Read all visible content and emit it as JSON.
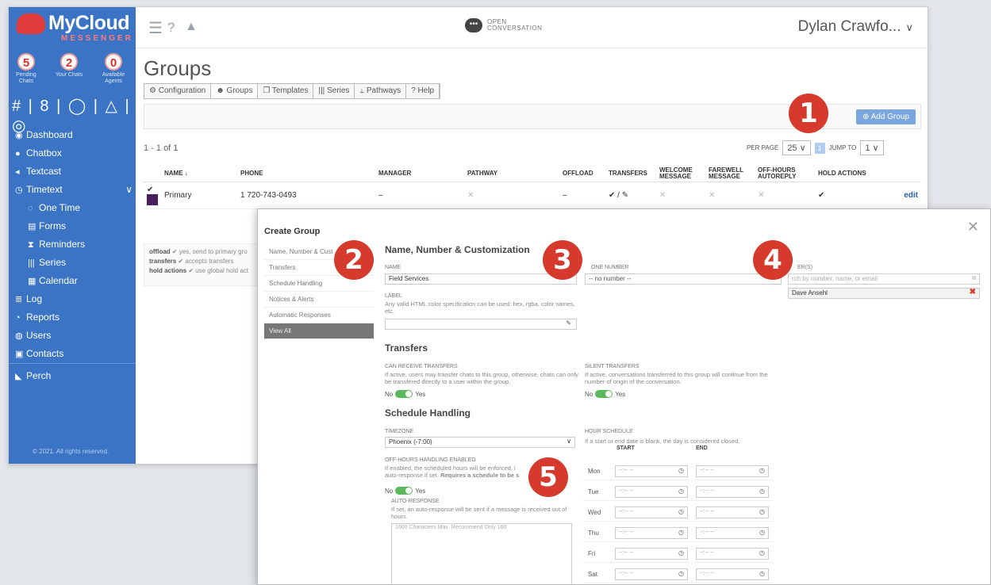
{
  "logo": {
    "title": "MyCloud",
    "subtitle": "MESSENGER"
  },
  "center_brand": {
    "line1": "OPEN",
    "line2": "CONVERSATION"
  },
  "user": {
    "name": "Dylan Crawfo..."
  },
  "stats": [
    {
      "num": "5",
      "label": "Pending Chats"
    },
    {
      "num": "2",
      "label": "Your Chats"
    },
    {
      "num": "0",
      "label": "Available Agents"
    }
  ],
  "sidebar": {
    "icons": "# | 8 | ◯ | △ | ◎",
    "items": [
      {
        "label": "Dashboard"
      },
      {
        "label": "Chatbox"
      },
      {
        "label": "Textcast"
      },
      {
        "label": "Timetext"
      },
      {
        "label": "One Time"
      },
      {
        "label": "Forms"
      },
      {
        "label": "Reminders"
      },
      {
        "label": "Series"
      },
      {
        "label": "Calendar"
      },
      {
        "label": "Log"
      },
      {
        "label": "Reports"
      },
      {
        "label": "Users"
      },
      {
        "label": "Contacts"
      },
      {
        "label": "Perch"
      }
    ],
    "copyright": "© 2021. All rights reserved."
  },
  "page": {
    "title": "Groups",
    "count": "1 - 1 of 1"
  },
  "tabs": [
    "Configuration",
    "Groups",
    "Templates",
    "Series",
    "Pathways",
    "Help"
  ],
  "actions": {
    "add_group": "Add Group"
  },
  "pagination": {
    "per_page_label": "PER PAGE",
    "per_page": "25",
    "page_btn": "1",
    "jump_label": "JUMP TO",
    "jump_value": "1"
  },
  "table": {
    "headers": [
      "NAME ↓",
      "PHONE",
      "MANAGER",
      "PATHWAY",
      "OFFLOAD",
      "TRANSFERS",
      "WELCOME MESSAGE",
      "FAREWELL MESSAGE",
      "OFF-HOURS AUTOREPLY",
      "HOLD ACTIONS",
      ""
    ],
    "row": {
      "name": "Primary",
      "phone": "1 720-743-0493",
      "manager": "–",
      "pathway": "✕",
      "offload": "–",
      "transfers": "✔ / ✎",
      "welcome": "✕",
      "farewell": "✕",
      "autoreply": "✕",
      "hold": "✔",
      "edit": "edit"
    }
  },
  "legend": {
    "offload_k": "offload",
    "offload_v": "✔ yes, send to primary gro",
    "transfers_k": "transfers",
    "transfers_v": "✔ accepts transfers",
    "hold_k": "hold actions",
    "hold_v": "✔ use global hold act"
  },
  "modal": {
    "title": "Create Group",
    "nav": [
      "Name, Number & Cust",
      "Transfers",
      "Schedule Handling",
      "Notices & Alerts",
      "Automatic Responses",
      "View All"
    ],
    "sec_name": "Name, Number & Customization",
    "name_label": "NAME",
    "name_value": "Field Services",
    "phone_label": "ONE NUMBER",
    "phone_value": "-- no number --",
    "managers_label": "ER(S)",
    "managers_placeholder": "rch by number, name, or email",
    "manager_item": "Dave Ansehl",
    "label_label": "LABEL",
    "label_desc": "Any valid HTML color specification can be used: hex, rgba, color names, etc.",
    "sec_transfers": "Transfers",
    "can_receive_label": "CAN RECEIVE TRANSFERS",
    "can_receive_desc": "If active, users may transfer chats to this group, otherwise, chats can only be transfered directly to a user within the group.",
    "silent_label": "SILENT TRANSFERS",
    "silent_desc": "If active, conversations transferred to this group will continue from the number of origin of the conversation.",
    "no": "No",
    "yes": "Yes",
    "sec_schedule": "Schedule Handling",
    "tz_label": "TIMEZONE",
    "tz_value": "Phoenix (-7:00)",
    "hour_label": "HOUR SCHEDULE",
    "hour_desc": "If a start or end date is blank, the day is considered closed.",
    "start": "START",
    "end": "END",
    "offhours_label": "OFF-HOURS HANDLING ENABLED",
    "offhours_desc1": "If enabled, the scheduled hours will be enforced, i",
    "offhours_desc2": "auto-response if set.",
    "offhours_desc_bold": "Requires a schedule to be s",
    "autoresp_label": "AUTO-RESPONSE",
    "autoresp_desc": "If set, an auto-response will be sent if a message is received out of hours.",
    "autoresp_placeholder": "1600 Characters Max.  Recommend Only 160",
    "days": [
      "Mon",
      "Tue",
      "Wed",
      "Thu",
      "Fri",
      "Sat"
    ],
    "time_placeholder": "--:-- --"
  },
  "callouts": [
    "1",
    "2",
    "3",
    "4",
    "5"
  ],
  "colors": {
    "brand_blue": "#3b74c5",
    "callout_red": "#d63a2d",
    "toggle_green": "#5cb85c",
    "group_purple": "#4a1e5e"
  }
}
